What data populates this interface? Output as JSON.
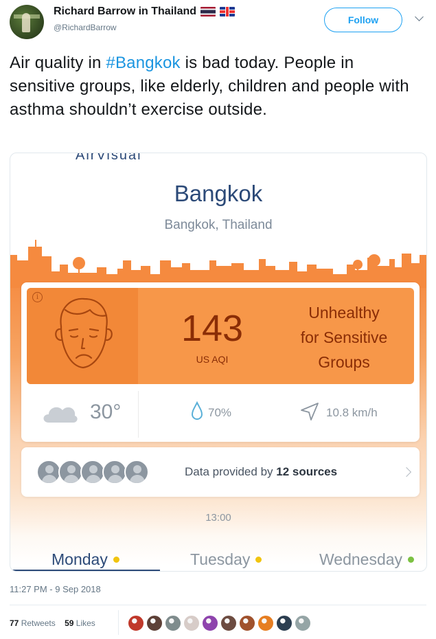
{
  "tweet": {
    "author_name": "Richard Barrow in Thailand",
    "handle": "@RichardBarrow",
    "follow_label": "Follow",
    "text_before": "Air quality in ",
    "hashtag": "#Bangkok",
    "text_after": " is bad today. People in sensitive groups, like elderly, children and people with asthma shouldn’t exercise outside.",
    "timestamp": "11:27 PM - 9 Sep 2018",
    "retweets_count": "77",
    "retweets_label": "Retweets",
    "likes_count": "59",
    "likes_label": "Likes",
    "liker_colors": [
      "#c0392b",
      "#5d4037",
      "#7f8c8d",
      "#d7ccc8",
      "#8e44ad",
      "#6d4c41",
      "#a0522d",
      "#e67e22",
      "#2c3e50",
      "#95a5a6"
    ]
  },
  "app": {
    "logo_text": "AirVisual",
    "city": "Bangkok",
    "location": "Bangkok, Thailand",
    "aqi_value": "143",
    "aqi_unit": "US AQI",
    "aqi_level_line1": "Unhealthy",
    "aqi_level_line2": "for Sensitive",
    "aqi_level_line3": "Groups",
    "info_icon_glyph": "i",
    "temperature": "30°",
    "humidity": "70%",
    "wind": "10.8 km/h",
    "sources_prefix": "Data provided by ",
    "sources_count": "12 sources",
    "time": "13:00",
    "days": [
      {
        "label": "Monday",
        "dot_color": "#f1c40f",
        "active": true
      },
      {
        "label": "Tuesday",
        "dot_color": "#f1c40f",
        "active": false
      },
      {
        "label": "Wednesday",
        "dot_color": "#7cc142",
        "active": false
      }
    ],
    "accent_color": "#f79749"
  }
}
